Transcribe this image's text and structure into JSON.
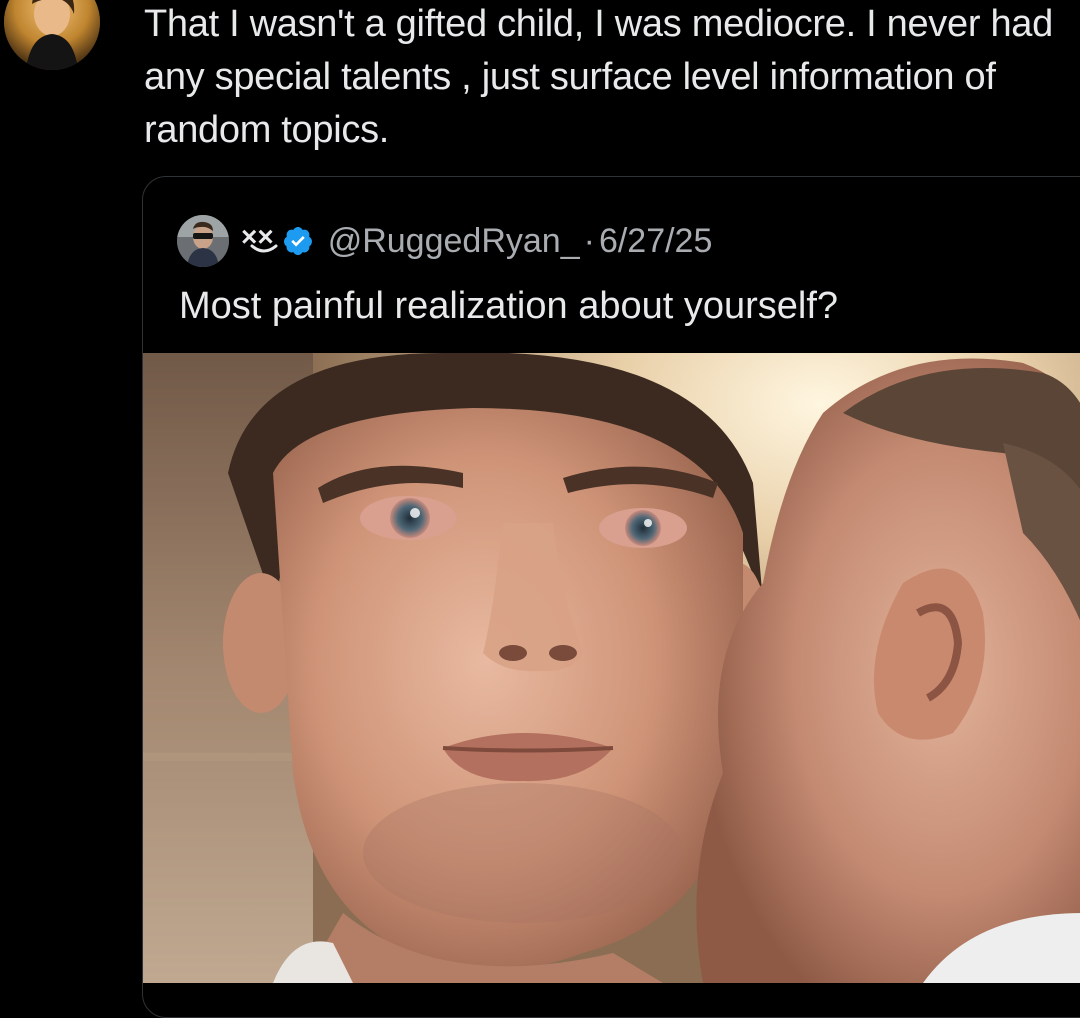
{
  "tweet": {
    "avatar_icon": "user-avatar-icon",
    "text": "That I wasn't a gifted child, I was mediocre. I never had any special talents , just surface level information of random topics."
  },
  "quote": {
    "display_name": "××",
    "verified_icon": "verified-badge-icon",
    "verified_color": "#1d9bf0",
    "handle": "@RuggedRyan_",
    "separator": "·",
    "date": "6/27/25",
    "text": "Most painful realization about yourself?",
    "media_icon": "photo-image-icon"
  },
  "colors": {
    "background": "#000000",
    "text_primary": "#e7e9ea",
    "text_secondary": "#a9adb1",
    "border": "#2f3336"
  }
}
